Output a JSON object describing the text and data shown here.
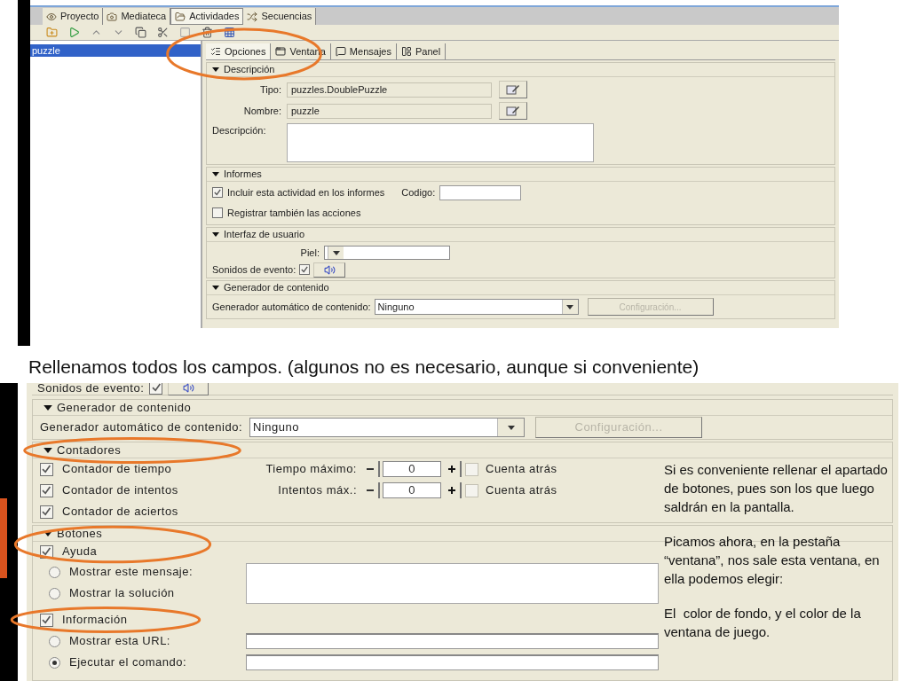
{
  "top_window": {
    "main_tabs": [
      {
        "label": "Proyecto",
        "selected": false
      },
      {
        "label": "Mediateca",
        "selected": false
      },
      {
        "label": "Actividades",
        "selected": true
      },
      {
        "label": "Secuencias",
        "selected": false
      }
    ],
    "activities": [
      {
        "label": "puzzle",
        "selected": true
      }
    ],
    "option_tabs": [
      {
        "label": "Opciones",
        "selected": true
      },
      {
        "label": "Ventana",
        "selected": false
      },
      {
        "label": "Mensajes",
        "selected": false
      },
      {
        "label": "Panel",
        "selected": false
      }
    ],
    "descripcion": {
      "title": "Descripción",
      "tipo_label": "Tipo:",
      "tipo_value": "puzzles.DoublePuzzle",
      "nombre_label": "Nombre:",
      "nombre_value": "puzzle",
      "descripcion_label": "Descripción:"
    },
    "informes": {
      "title": "Informes",
      "include": {
        "label": "Incluir esta actividad en los informes",
        "checked": true
      },
      "codigo_label": "Codigo:",
      "register": {
        "label": "Registrar también las acciones",
        "checked": false
      }
    },
    "interfaz": {
      "title": "Interfaz de usuario",
      "piel_label": "Piel:",
      "sonidos_label": "Sonidos de evento:",
      "sonidos_checked": true
    },
    "generador": {
      "title": "Generador de contenido",
      "label": "Generador automático de contenido:",
      "value": "Ninguno",
      "button": "Configuración...",
      "button_disabled": true
    }
  },
  "caption": "Rellenamos todos los campos. (algunos no es necesario, aunque si conveniente)",
  "bottom_window": {
    "sonidos": {
      "label": "Sonidos de evento:",
      "checked": true
    },
    "generador": {
      "title": "Generador de contenido",
      "label": "Generador automático de contenido:",
      "value": "Ninguno",
      "button": "Configuración...",
      "button_disabled": true
    },
    "contadores": {
      "title": "Contadores",
      "rows": [
        {
          "label": "Contador de tiempo",
          "checked": true,
          "limit_label": "Tiempo máximo:",
          "value": "0",
          "countdown": {
            "label": "Cuenta atrás",
            "checked": false,
            "disabled": true
          }
        },
        {
          "label": "Contador de intentos",
          "checked": true,
          "limit_label": "Intentos máx.:",
          "value": "0",
          "countdown": {
            "label": "Cuenta atrás",
            "checked": false,
            "disabled": true
          }
        },
        {
          "label": "Contador de aciertos",
          "checked": true
        }
      ]
    },
    "botones": {
      "title": "Botones",
      "ayuda": {
        "label": "Ayuda",
        "checked": true
      },
      "ayuda_options": [
        {
          "label": "Mostrar este mensaje:",
          "selected": false
        },
        {
          "label": "Mostrar la solución",
          "selected": false
        }
      ],
      "informacion": {
        "label": "Información",
        "checked": true
      },
      "info_options": [
        {
          "label": "Mostrar esta URL:",
          "selected": false
        },
        {
          "label": "Ejecutar el comando:",
          "selected": true
        }
      ]
    }
  },
  "notes": [
    "Si es conveniente rellenar el apartado  de botones, pues son los que luego saldrán en la pantalla.",
    "Picamos ahora, en la pestaña “ventana”, nos sale esta ventana, en ella podemos elegir:",
    "El  color de fondo, y el color de la ventana de juego."
  ]
}
